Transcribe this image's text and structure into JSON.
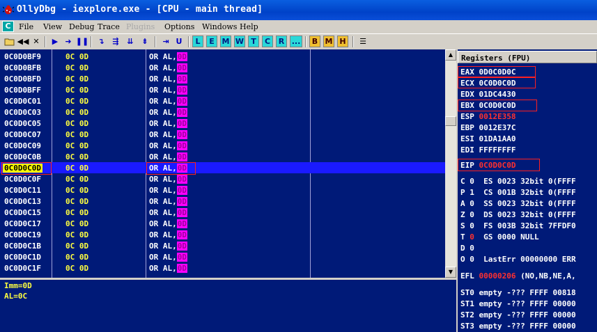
{
  "window": {
    "title": "OllyDbg - iexplore.exe - [CPU - main thread]",
    "title_bar_color": "#0a5fe0"
  },
  "menu": {
    "c_button": "C",
    "items": [
      {
        "label": "File",
        "disabled": false
      },
      {
        "label": "View",
        "disabled": false
      },
      {
        "label": "Debug",
        "disabled": false
      },
      {
        "label": "Trace",
        "disabled": false
      },
      {
        "label": "Plugins",
        "disabled": true
      },
      {
        "label": "Options",
        "disabled": false
      },
      {
        "label": "Windows",
        "disabled": false
      },
      {
        "label": "Help",
        "disabled": false
      }
    ]
  },
  "toolbar": {
    "letter_buttons": [
      "L",
      "E",
      "M",
      "W",
      "T",
      "C",
      "R",
      "...",
      "B",
      "M",
      "H"
    ]
  },
  "cpu": {
    "rows": [
      {
        "addr": "0C0D0BF9",
        "hex": "0C 0D",
        "mnem": "OR AL,",
        "imm": "0D",
        "selected": false
      },
      {
        "addr": "0C0D0BFB",
        "hex": "0C 0D",
        "mnem": "OR AL,",
        "imm": "0D",
        "selected": false
      },
      {
        "addr": "0C0D0BFD",
        "hex": "0C 0D",
        "mnem": "OR AL,",
        "imm": "0D",
        "selected": false
      },
      {
        "addr": "0C0D0BFF",
        "hex": "0C 0D",
        "mnem": "OR AL,",
        "imm": "0D",
        "selected": false
      },
      {
        "addr": "0C0D0C01",
        "hex": "0C 0D",
        "mnem": "OR AL,",
        "imm": "0D",
        "selected": false
      },
      {
        "addr": "0C0D0C03",
        "hex": "0C 0D",
        "mnem": "OR AL,",
        "imm": "0D",
        "selected": false
      },
      {
        "addr": "0C0D0C05",
        "hex": "0C 0D",
        "mnem": "OR AL,",
        "imm": "0D",
        "selected": false
      },
      {
        "addr": "0C0D0C07",
        "hex": "0C 0D",
        "mnem": "OR AL,",
        "imm": "0D",
        "selected": false
      },
      {
        "addr": "0C0D0C09",
        "hex": "0C 0D",
        "mnem": "OR AL,",
        "imm": "0D",
        "selected": false
      },
      {
        "addr": "0C0D0C0B",
        "hex": "0C 0D",
        "mnem": "OR AL,",
        "imm": "0D",
        "selected": false
      },
      {
        "addr": "0C0D0C0D",
        "hex": "0C 0D",
        "mnem": "OR AL,",
        "imm": "0D",
        "selected": true
      },
      {
        "addr": "0C0D0C0F",
        "hex": "0C 0D",
        "mnem": "OR AL,",
        "imm": "0D",
        "selected": false
      },
      {
        "addr": "0C0D0C11",
        "hex": "0C 0D",
        "mnem": "OR AL,",
        "imm": "0D",
        "selected": false
      },
      {
        "addr": "0C0D0C13",
        "hex": "0C 0D",
        "mnem": "OR AL,",
        "imm": "0D",
        "selected": false
      },
      {
        "addr": "0C0D0C15",
        "hex": "0C 0D",
        "mnem": "OR AL,",
        "imm": "0D",
        "selected": false
      },
      {
        "addr": "0C0D0C17",
        "hex": "0C 0D",
        "mnem": "OR AL,",
        "imm": "0D",
        "selected": false
      },
      {
        "addr": "0C0D0C19",
        "hex": "0C 0D",
        "mnem": "OR AL,",
        "imm": "0D",
        "selected": false
      },
      {
        "addr": "0C0D0C1B",
        "hex": "0C 0D",
        "mnem": "OR AL,",
        "imm": "0D",
        "selected": false
      },
      {
        "addr": "0C0D0C1D",
        "hex": "0C 0D",
        "mnem": "OR AL,",
        "imm": "0D",
        "selected": false
      },
      {
        "addr": "0C0D0C1F",
        "hex": "0C 0D",
        "mnem": "OR AL,",
        "imm": "0D",
        "selected": false
      }
    ],
    "pane_color": "#001a78",
    "selection_color": "#1a1aff",
    "immediate_highlight_color": "#ff00ff"
  },
  "info": {
    "lines": [
      "Imm=0D",
      "AL=0C"
    ]
  },
  "registers": {
    "header": "Registers (FPU)",
    "gp": [
      {
        "name": "EAX",
        "value": "0D0C0D0C",
        "changed": false
      },
      {
        "name": "ECX",
        "value": "0C0D0C0D",
        "changed": false
      },
      {
        "name": "EDX",
        "value": "01DC4430",
        "changed": false
      },
      {
        "name": "EBX",
        "value": "0C0D0C0D",
        "changed": false
      },
      {
        "name": "ESP",
        "value": "0012E358",
        "changed": true
      },
      {
        "name": "EBP",
        "value": "0012E37C",
        "changed": false
      },
      {
        "name": "ESI",
        "value": "01DA1AA0",
        "changed": false
      },
      {
        "name": "EDI",
        "value": "FFFFFFFF",
        "changed": false
      }
    ],
    "eip": {
      "name": "EIP",
      "value": "0C0D0C0D"
    },
    "flags": [
      {
        "flag": "C",
        "val": "0",
        "seg": "ES 0023 32bit 0(FFFF"
      },
      {
        "flag": "P",
        "val": "1",
        "seg": "CS 001B 32bit 0(FFFF"
      },
      {
        "flag": "A",
        "val": "0",
        "seg": "SS 0023 32bit 0(FFFF"
      },
      {
        "flag": "Z",
        "val": "0",
        "seg": "DS 0023 32bit 0(FFFF"
      },
      {
        "flag": "S",
        "val": "0",
        "seg": "FS 003B 32bit 7FFDF0"
      },
      {
        "flag": "T",
        "val": "0",
        "seg": "GS 0000 NULL"
      },
      {
        "flag": "D",
        "val": "0",
        "seg": ""
      },
      {
        "flag": "O",
        "val": "0",
        "seg": "LastErr 00000000 ERR"
      }
    ],
    "efl": {
      "name": "EFL",
      "value": "00000206",
      "desc": "(NO,NB,NE,A,"
    },
    "fpu": [
      "ST0 empty -??? FFFF 00818",
      "ST1 empty -??? FFFF 00000",
      "ST2 empty -??? FFFF 00000",
      "ST3 empty -??? FFFF 00000"
    ]
  }
}
